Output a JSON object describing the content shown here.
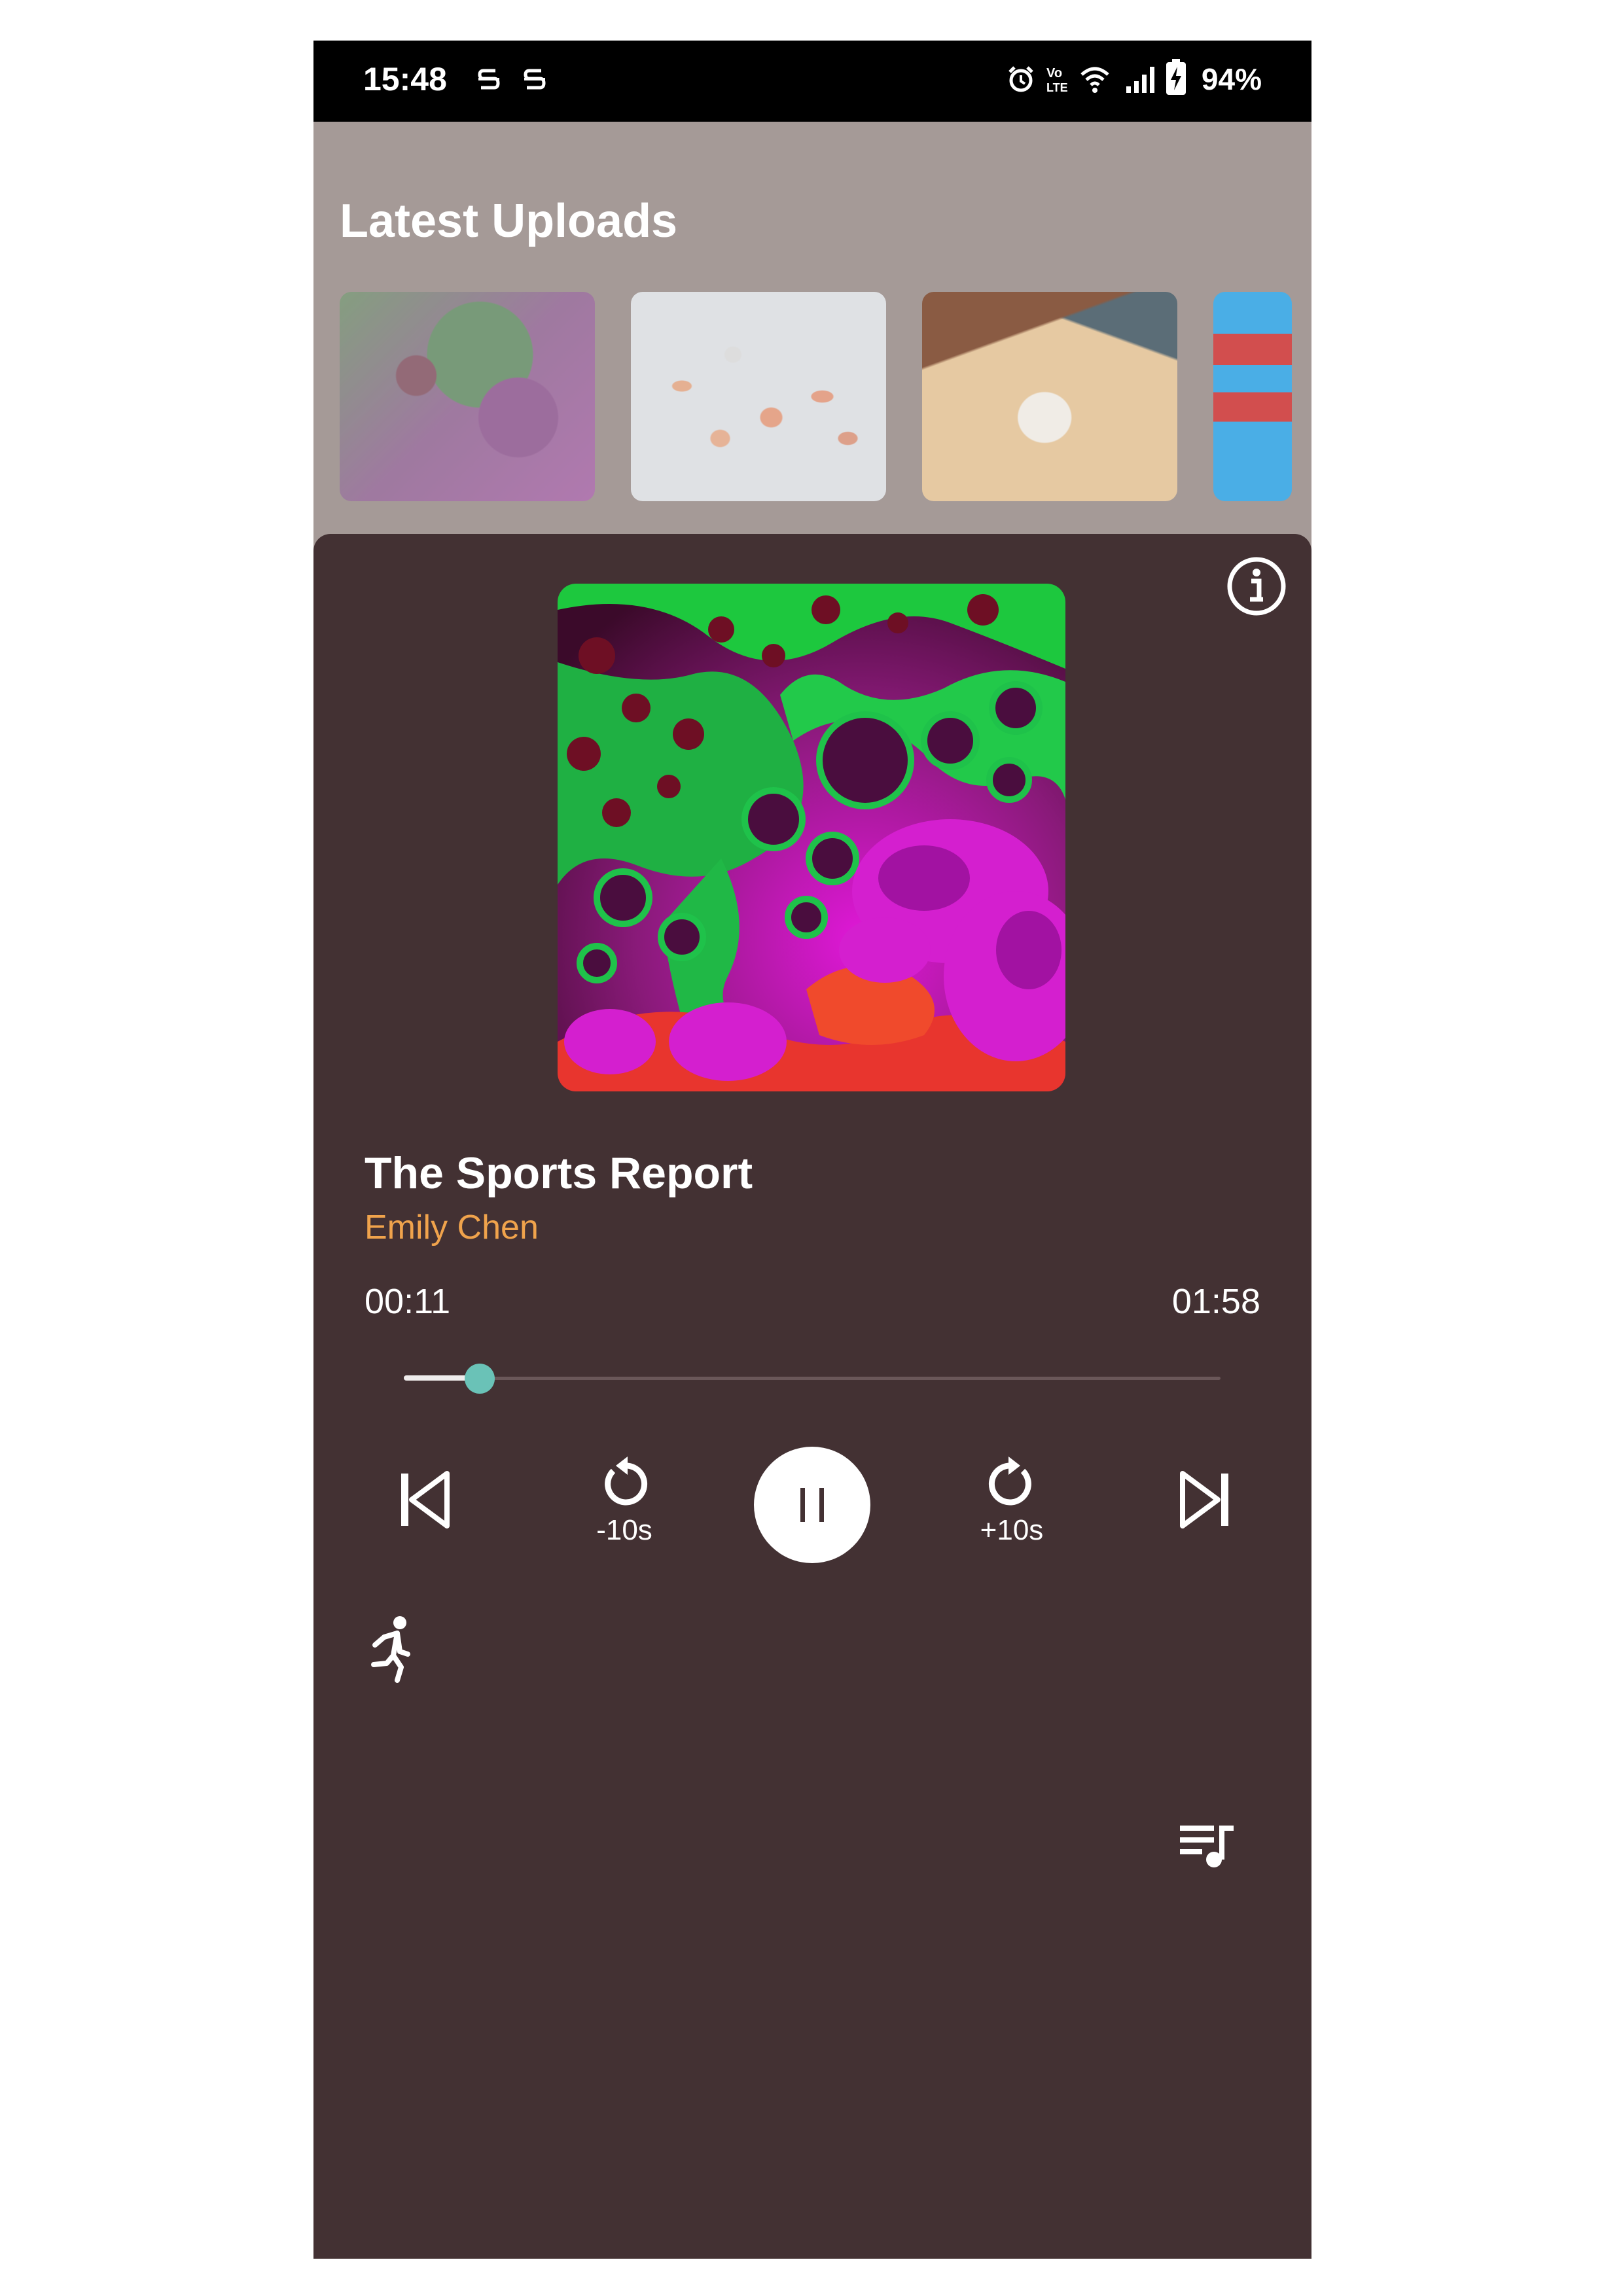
{
  "status_bar": {
    "time": "15:48",
    "battery_percent": "94%",
    "icons": [
      "s-notification-icon",
      "s-notification-icon",
      "alarm-icon",
      "volte-icon",
      "wifi-icon",
      "signal-icon",
      "battery-charging-icon"
    ]
  },
  "library": {
    "section_title": "Latest Uploads",
    "thumbnails": [
      {
        "name": "marbled-art-thumbnail",
        "now_playing": true
      },
      {
        "name": "eggs-thumbnail"
      },
      {
        "name": "desk-flatlay-thumbnail"
      },
      {
        "name": "blue-notebook-thumbnail"
      }
    ]
  },
  "player": {
    "title": "The Sports Report",
    "artist": "Emily Chen",
    "elapsed": "00:11",
    "duration": "01:58",
    "progress_fraction": 0.093,
    "rewind_label": "-10s",
    "forward_label": "+10s",
    "state": "playing",
    "icons": [
      "info-icon",
      "skip-previous-icon",
      "replay-icon",
      "pause-icon",
      "forward-icon",
      "skip-next-icon",
      "running-person-icon",
      "queue-music-icon"
    ]
  },
  "colors": {
    "sheet_background": "#433133",
    "artist_accent": "#f0a34c",
    "seek_thumb": "#6ac2b7",
    "status_bar": "#000000",
    "backdrop": "#a59a97"
  }
}
